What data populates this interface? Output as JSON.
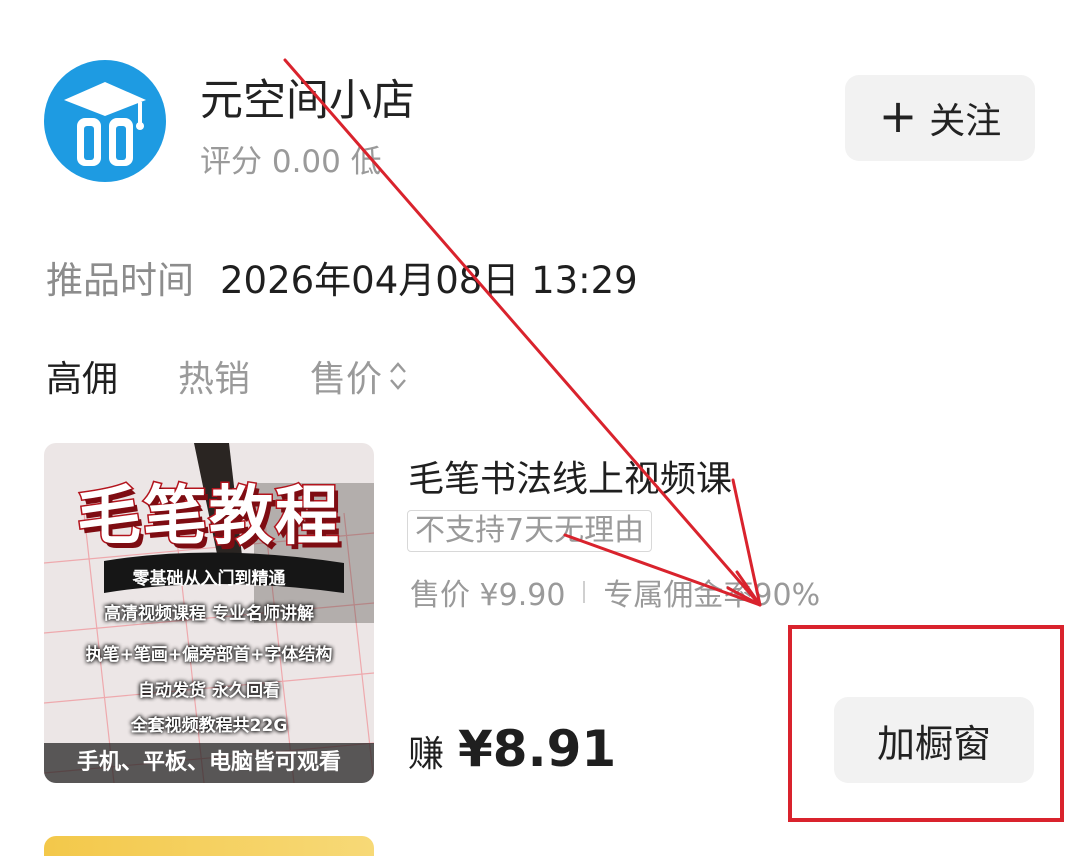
{
  "shop": {
    "name": "元空间小店",
    "rating": "评分 0.00 低",
    "follow_label": "关注"
  },
  "push_time": {
    "label": "推品时间",
    "value": "2026年04月08日 13:29"
  },
  "sort_tabs": [
    {
      "label": "高佣",
      "active": true
    },
    {
      "label": "热销",
      "active": false
    },
    {
      "label": "售价",
      "active": false
    }
  ],
  "product": {
    "thumb_text": {
      "big_title": "毛笔教程",
      "lines": [
        "零基础从入门到精通",
        "高清视频课程 专业名师讲解",
        "执笔+笔画+偏旁部首+字体结构",
        "自动发货 永久回看",
        "全套视频教程共22G"
      ],
      "bottom": "手机、平板、电脑皆可观看"
    },
    "title": "毛笔书法线上视频课",
    "tag": "不支持7天无理由",
    "price": "售价 ¥9.90",
    "commission": "专属佣金率90%",
    "earn_label": "赚",
    "earn_value": "¥8.91",
    "add_label": "加橱窗"
  },
  "colors": {
    "logo_blue": "#1e9be2",
    "annotation_red": "#d9232d",
    "button_bg": "#f2f2f2"
  }
}
